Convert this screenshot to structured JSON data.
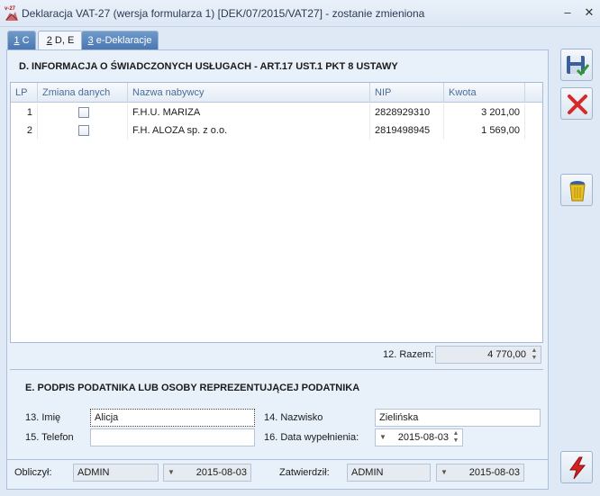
{
  "window": {
    "title": "Deklaracja VAT-27 (wersja formularza 1) [DEK/07/2015/VAT27] - zostanie zmieniona",
    "icon_badge": "v-27",
    "controls": [
      "minimize-icon",
      "close-icon"
    ]
  },
  "tabs": [
    {
      "key": "1",
      "label": " C",
      "active": false
    },
    {
      "key": "2",
      "label": " D, E",
      "active": true
    },
    {
      "key": "3",
      "label": " e-Deklaracje",
      "active": false
    }
  ],
  "sectionD": {
    "title": "D. INFORMACJA O ŚWIADCZONYCH USŁUGACH - ART.17 UST.1 PKT 8 USTAWY",
    "columns": [
      "LP",
      "Zmiana danych",
      "Nazwa nabywcy",
      "NIP",
      "Kwota"
    ],
    "rows": [
      {
        "lp": "1",
        "zmiana": false,
        "nazwa": "F.H.U. MARIZA",
        "nip": "2828929310",
        "kwota": "3 201,00"
      },
      {
        "lp": "2",
        "zmiana": false,
        "nazwa": "F.H. ALOZA sp. z o.o.",
        "nip": "2819498945",
        "kwota": "1 569,00"
      }
    ],
    "razem_label": "12. Razem:",
    "razem_value": "4 770,00"
  },
  "sectionE": {
    "title": "E. PODPIS PODATNIKA LUB OSOBY REPREZENTUJĄCEJ PODATNIKA",
    "imie_label": "13. Imię",
    "imie_value": "Alicja",
    "nazwisko_label": "14. Nazwisko",
    "nazwisko_value": "Zielińska",
    "telefon_label": "15. Telefon",
    "telefon_value": "",
    "data_label": "16. Data wypełnienia:",
    "data_value": "2015-08-03"
  },
  "footer": {
    "obliczyl_label": "Obliczył:",
    "obliczyl_user": "ADMIN",
    "obliczyl_date": "2015-08-03",
    "zatwierdzil_label": "Zatwierdził:",
    "zatwierdzil_user": "ADMIN",
    "zatwierdzil_date": "2015-08-03"
  },
  "side_buttons": [
    "save-icon",
    "cancel-icon",
    "delete-bin-icon",
    "lightning-icon"
  ]
}
